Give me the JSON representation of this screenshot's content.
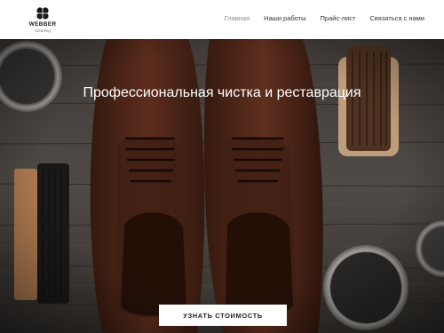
{
  "header": {
    "logo": {
      "name": "WEBBER",
      "sub": "Cleaning",
      "icon": "clover-icon"
    },
    "nav": [
      {
        "label": "Главная",
        "active": true
      },
      {
        "label": "Наши работы",
        "active": false
      },
      {
        "label": "Прайс-лист",
        "active": false
      },
      {
        "label": "Связаться с нами",
        "active": false
      }
    ]
  },
  "hero": {
    "title": "Профессиональная чистка и реставрация",
    "cta_label": "УЗНАТЬ СТОИМОСТЬ",
    "image": "shoe-care-photo"
  },
  "colors": {
    "header_bg": "#ffffff",
    "hero_overlay": "#3a3734",
    "cta_bg": "#ffffff",
    "text_light": "#ffffff"
  }
}
